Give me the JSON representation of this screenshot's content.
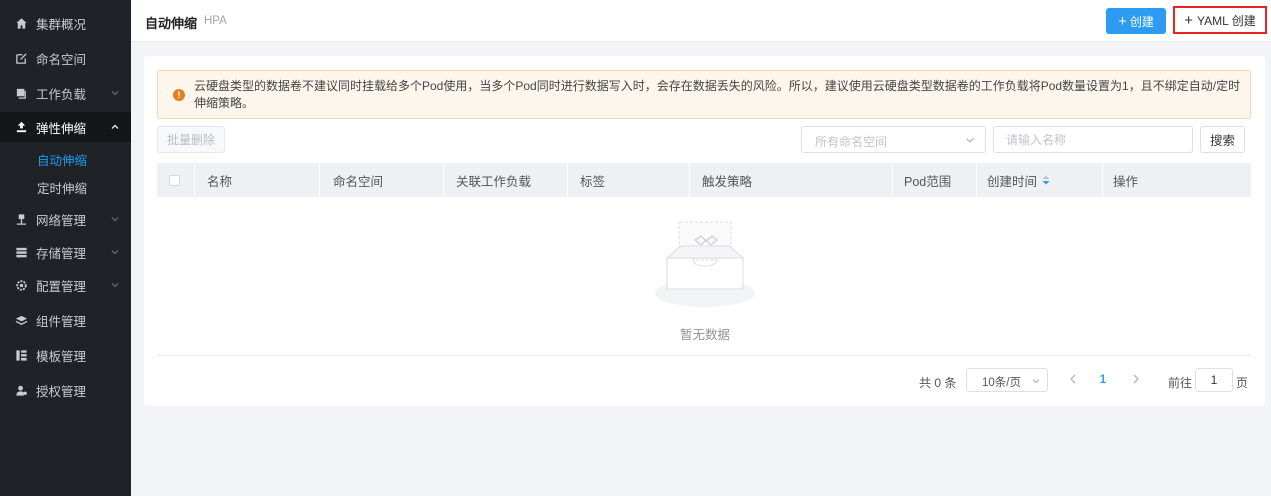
{
  "sidebar": {
    "items": [
      {
        "label": "集群概况",
        "icon": "home-icon"
      },
      {
        "label": "命名空间",
        "icon": "edit-square-icon"
      },
      {
        "label": "工作负载",
        "icon": "workload-icon"
      },
      {
        "label": "弹性伸缩",
        "icon": "scaling-icon"
      },
      {
        "label": "网络管理",
        "icon": "network-icon"
      },
      {
        "label": "存储管理",
        "icon": "storage-icon"
      },
      {
        "label": "配置管理",
        "icon": "gear-icon"
      },
      {
        "label": "组件管理",
        "icon": "layers-icon"
      },
      {
        "label": "模板管理",
        "icon": "template-icon"
      },
      {
        "label": "授权管理",
        "icon": "user-auth-icon"
      }
    ],
    "sub_items": [
      {
        "label": "自动伸缩"
      },
      {
        "label": "定时伸缩"
      }
    ]
  },
  "header": {
    "title": "自动伸缩",
    "subtitle": "HPA",
    "create_label": "创建",
    "yaml_create_label": "YAML 创建"
  },
  "alert": {
    "text": "云硬盘类型的数据卷不建议同时挂载给多个Pod使用，当多个Pod同时进行数据写入时，会存在数据丢失的风险。所以，建议使用云硬盘类型数据卷的工作负载将Pod数量设置为1，且不绑定自动/定时伸缩策略。"
  },
  "toolbar": {
    "batch_delete_label": "批量删除",
    "namespace_placeholder": "所有命名空间",
    "name_placeholder": "请输入名称",
    "search_label": "搜索"
  },
  "table": {
    "columns": [
      "名称",
      "命名空间",
      "关联工作负载",
      "标签",
      "触发策略",
      "Pod范围",
      "创建时间",
      "操作"
    ],
    "rows": [],
    "empty_text": "暂无数据"
  },
  "pagination": {
    "total_text": "共 0 条",
    "page_size": "10条/页",
    "current_page": "1",
    "goto_label": "前往",
    "goto_value": "1",
    "goto_unit": "页"
  },
  "colors": {
    "sidebar_bg": "#1f2226",
    "accent": "#2d9cf0",
    "highlight_border": "#e52323",
    "alert_bg": "#fdf6ec",
    "alert_icon": "#e6801e"
  }
}
